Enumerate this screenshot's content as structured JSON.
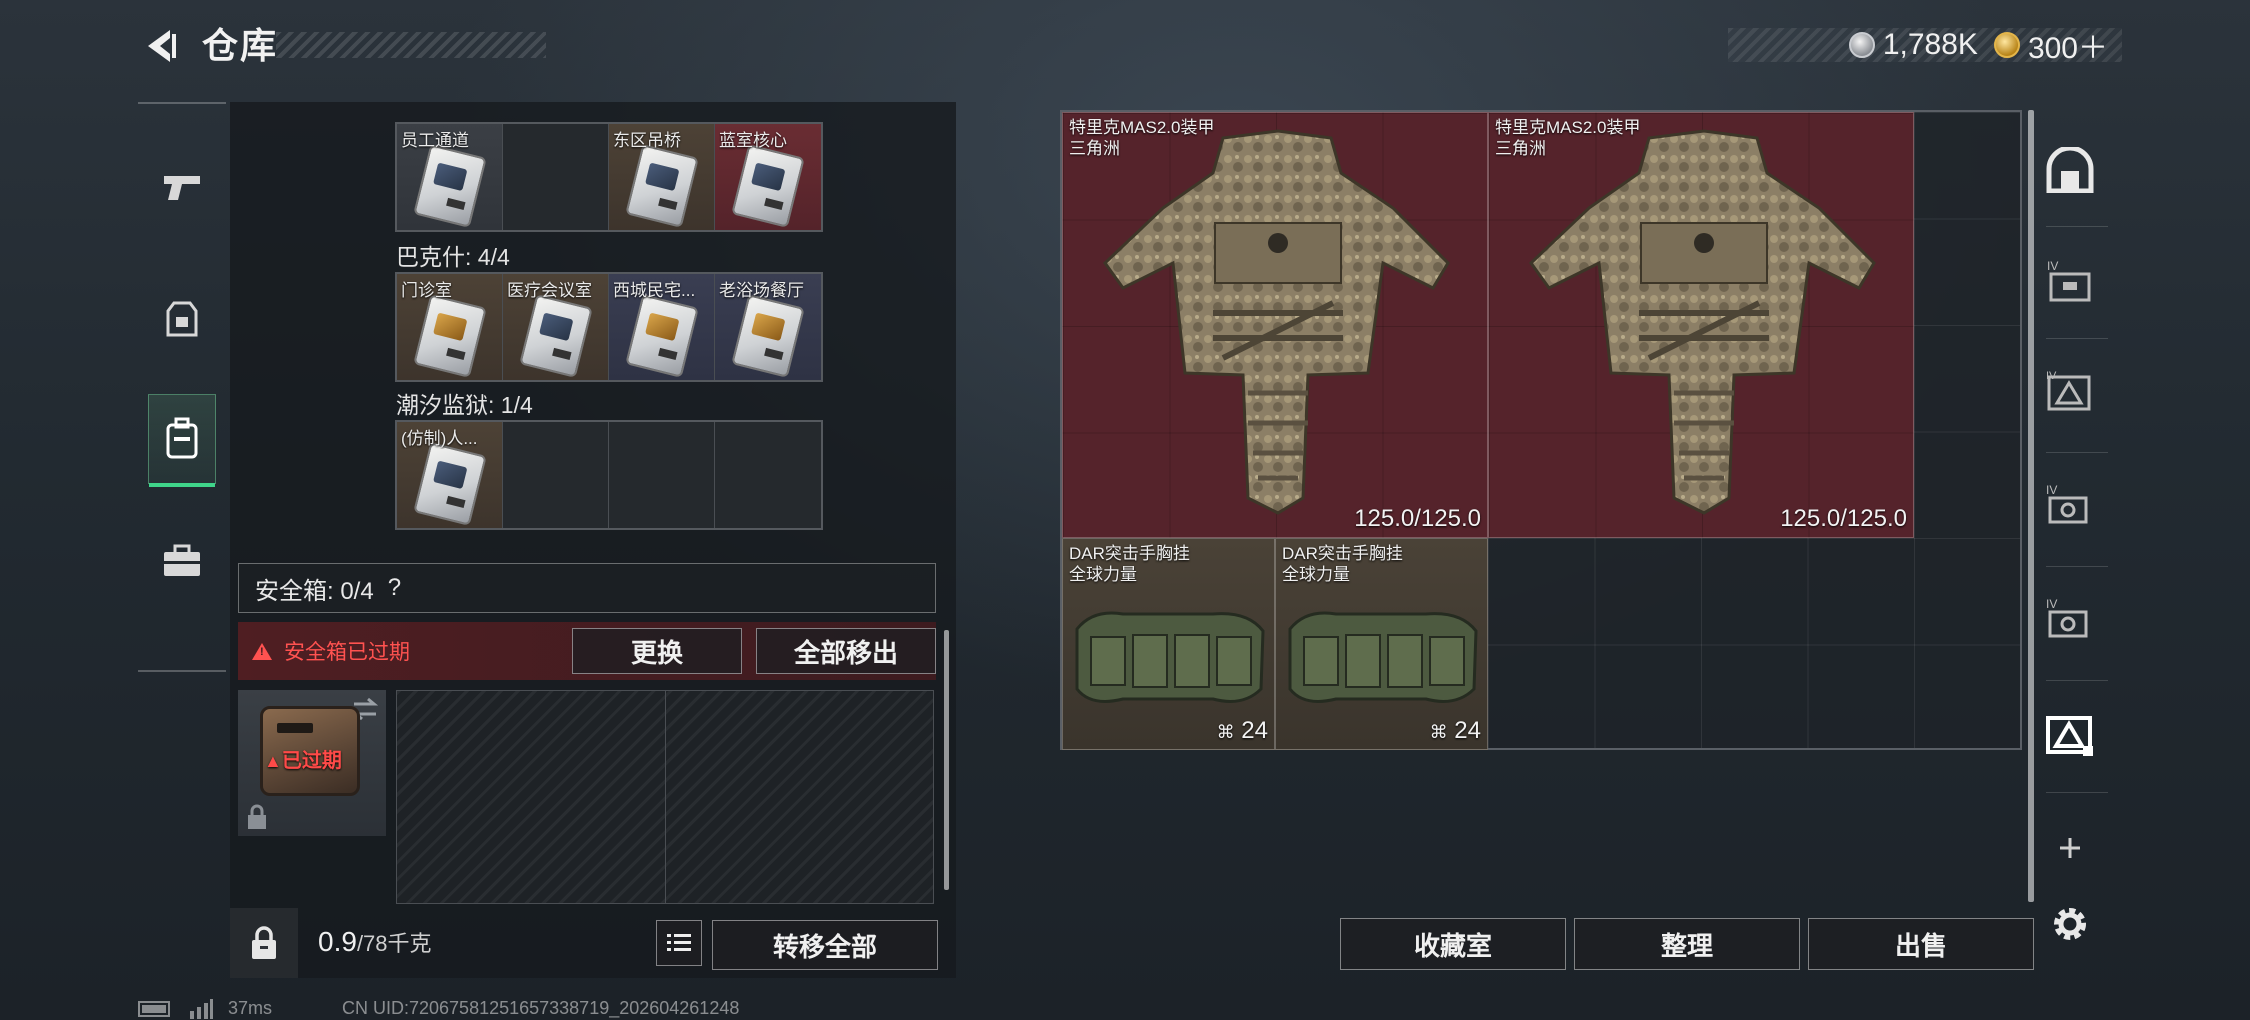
{
  "header": {
    "title": "仓库",
    "currencies": [
      {
        "icon": "silver-coin-icon",
        "value": "1,788K"
      },
      {
        "icon": "gold-coin-icon",
        "value": "300＋"
      }
    ]
  },
  "left_nav": {
    "items": [
      {
        "name": "weapons",
        "icon": "pistol-icon",
        "active": false
      },
      {
        "name": "armor",
        "icon": "vest-icon",
        "active": false
      },
      {
        "name": "backpack",
        "icon": "backpack-icon",
        "active": true
      },
      {
        "name": "toolbox",
        "icon": "toolbox-icon",
        "active": false
      }
    ]
  },
  "key_groups": [
    {
      "title": "",
      "cells": [
        {
          "label": "员工通道",
          "bg": "gray",
          "card": "silver"
        },
        {
          "label": "",
          "bg": "empty"
        },
        {
          "label": "东区吊桥",
          "bg": "tan",
          "card": "silver"
        },
        {
          "label": "蓝室核心",
          "bg": "red",
          "card": "silver"
        }
      ]
    },
    {
      "title": "巴克什: 4/4",
      "cells": [
        {
          "label": "门诊室",
          "bg": "tan",
          "card": "gold"
        },
        {
          "label": "医疗会议室",
          "bg": "tan",
          "card": "silver"
        },
        {
          "label": "西城民宅...",
          "bg": "navy",
          "card": "gold"
        },
        {
          "label": "老浴场餐厅",
          "bg": "navy",
          "card": "gold"
        }
      ]
    },
    {
      "title": "潮汐监狱: 1/4",
      "cells": [
        {
          "label": "(仿制)人...",
          "bg": "tan",
          "card": "silver"
        },
        {
          "label": "",
          "bg": "empty"
        },
        {
          "label": "",
          "bg": "empty"
        },
        {
          "label": "",
          "bg": "empty"
        }
      ]
    }
  ],
  "safe_box": {
    "header": "安全箱: 0/4",
    "help": "?",
    "warning": "安全箱已过期",
    "replace_label": "更换",
    "move_all_out_label": "全部移出",
    "expired_label": "已过期"
  },
  "bottom_left": {
    "weight_value": "0.9",
    "weight_capacity": "/78千克",
    "transfer_all_label": "转移全部"
  },
  "stash_items": [
    {
      "name": "特里克MAS2.0装甲",
      "sub": "三角洲",
      "value": "125.0/125.0",
      "kind": "armor"
    },
    {
      "name": "特里克MAS2.0装甲",
      "sub": "三角洲",
      "value": "125.0/125.0",
      "kind": "armor"
    },
    {
      "name": "DAR突击手胸挂",
      "sub": "全球力量",
      "value": "24",
      "kind": "rig"
    },
    {
      "name": "DAR突击手胸挂",
      "sub": "全球力量",
      "value": "24",
      "kind": "rig"
    }
  ],
  "stash_buttons": {
    "collection_label": "收藏室",
    "sort_label": "整理",
    "sell_label": "出售"
  },
  "right_sidebar": {
    "icons": [
      "bunker-icon",
      "folder-tier4-icon",
      "warning-crate-icon",
      "tier4-case-icon",
      "tier4-case-alt-icon",
      "active-crate-icon",
      "add-icon",
      "settings-icon"
    ]
  },
  "status_bar": {
    "ping": "37ms",
    "uid": "CN UID:72067581251657338719_202604261248"
  },
  "colors": {
    "accent_green": "#3fd58a",
    "warning_red": "#ff5250",
    "armor_bg": "#55232b"
  }
}
